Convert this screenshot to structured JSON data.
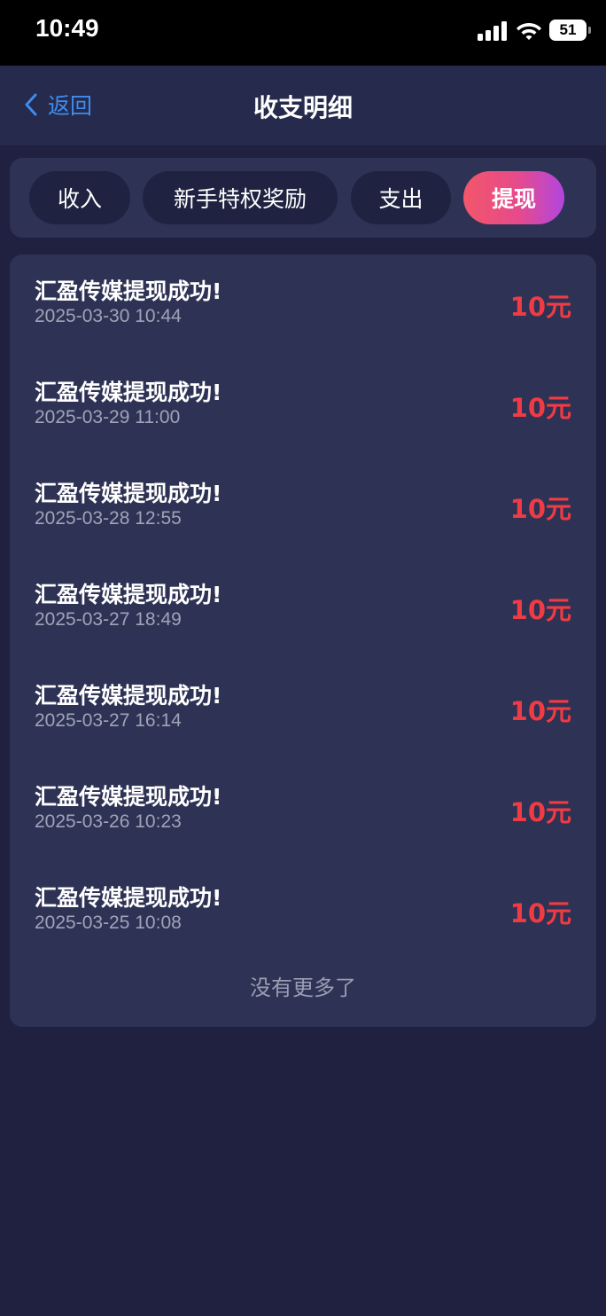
{
  "status_bar": {
    "time": "10:49",
    "battery": "51"
  },
  "nav": {
    "back_label": "返回",
    "title": "收支明细"
  },
  "tabs": [
    {
      "label": "收入",
      "active": false
    },
    {
      "label": "新手特权奖励",
      "active": false
    },
    {
      "label": "支出",
      "active": false
    },
    {
      "label": "提现",
      "active": true
    }
  ],
  "records": [
    {
      "title": "汇盈传媒提现成功!",
      "date": "2025-03-30 10:44",
      "amount": "10元"
    },
    {
      "title": "汇盈传媒提现成功!",
      "date": "2025-03-29 11:00",
      "amount": "10元"
    },
    {
      "title": "汇盈传媒提现成功!",
      "date": "2025-03-28 12:55",
      "amount": "10元"
    },
    {
      "title": "汇盈传媒提现成功!",
      "date": "2025-03-27 18:49",
      "amount": "10元"
    },
    {
      "title": "汇盈传媒提现成功!",
      "date": "2025-03-27 16:14",
      "amount": "10元"
    },
    {
      "title": "汇盈传媒提现成功!",
      "date": "2025-03-26 10:23",
      "amount": "10元"
    },
    {
      "title": "汇盈传媒提现成功!",
      "date": "2025-03-25 10:08",
      "amount": "10元"
    }
  ],
  "footer_text": "没有更多了",
  "colors": {
    "background": "#202040",
    "card": "#2e3254",
    "amount": "#f13b44",
    "link": "#3f8cf0"
  }
}
